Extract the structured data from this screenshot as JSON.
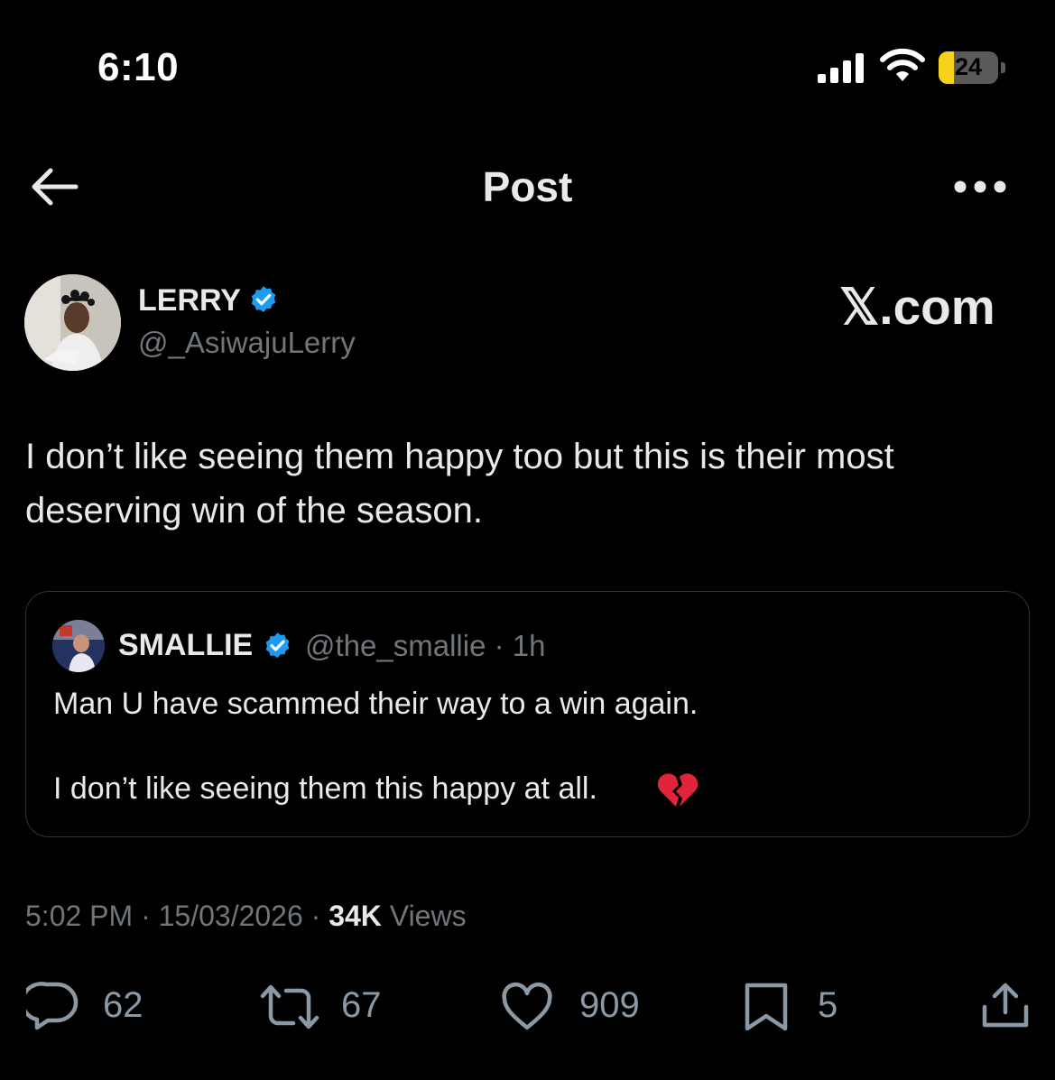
{
  "status_bar": {
    "time": "6:10",
    "battery": "24",
    "battery_color": "#f5d21c"
  },
  "header": {
    "title": "Post",
    "back_icon": "arrow-left-icon",
    "more_icon": "more-horizontal-icon"
  },
  "author": {
    "name": "LERRY",
    "handle": "@_AsiwajuLerry",
    "verified": true,
    "verified_color": "#1d9bf0"
  },
  "watermark": "𝕏.com",
  "post": {
    "text": "I don’t like seeing them happy too but this is their most deserving win of the season."
  },
  "quote": {
    "name": "SMALLIE",
    "handle": "@the_smallie",
    "time": "1h",
    "line1": "Man U have scammed their way to a win again.",
    "line2": "I don’t like seeing them this happy at all.",
    "emoji": "broken-heart-icon"
  },
  "meta": {
    "time": "5:02 PM",
    "date": "15/03/2026",
    "views_count": "34K",
    "views_label": "Views"
  },
  "actions": {
    "replies": "62",
    "reposts": "67",
    "likes": "909",
    "bookmarks": "5"
  },
  "colors": {
    "background": "#000000",
    "text": "#e7e9ea",
    "secondary": "#71767b",
    "border": "#2f3336",
    "accent": "#1d9bf0"
  }
}
